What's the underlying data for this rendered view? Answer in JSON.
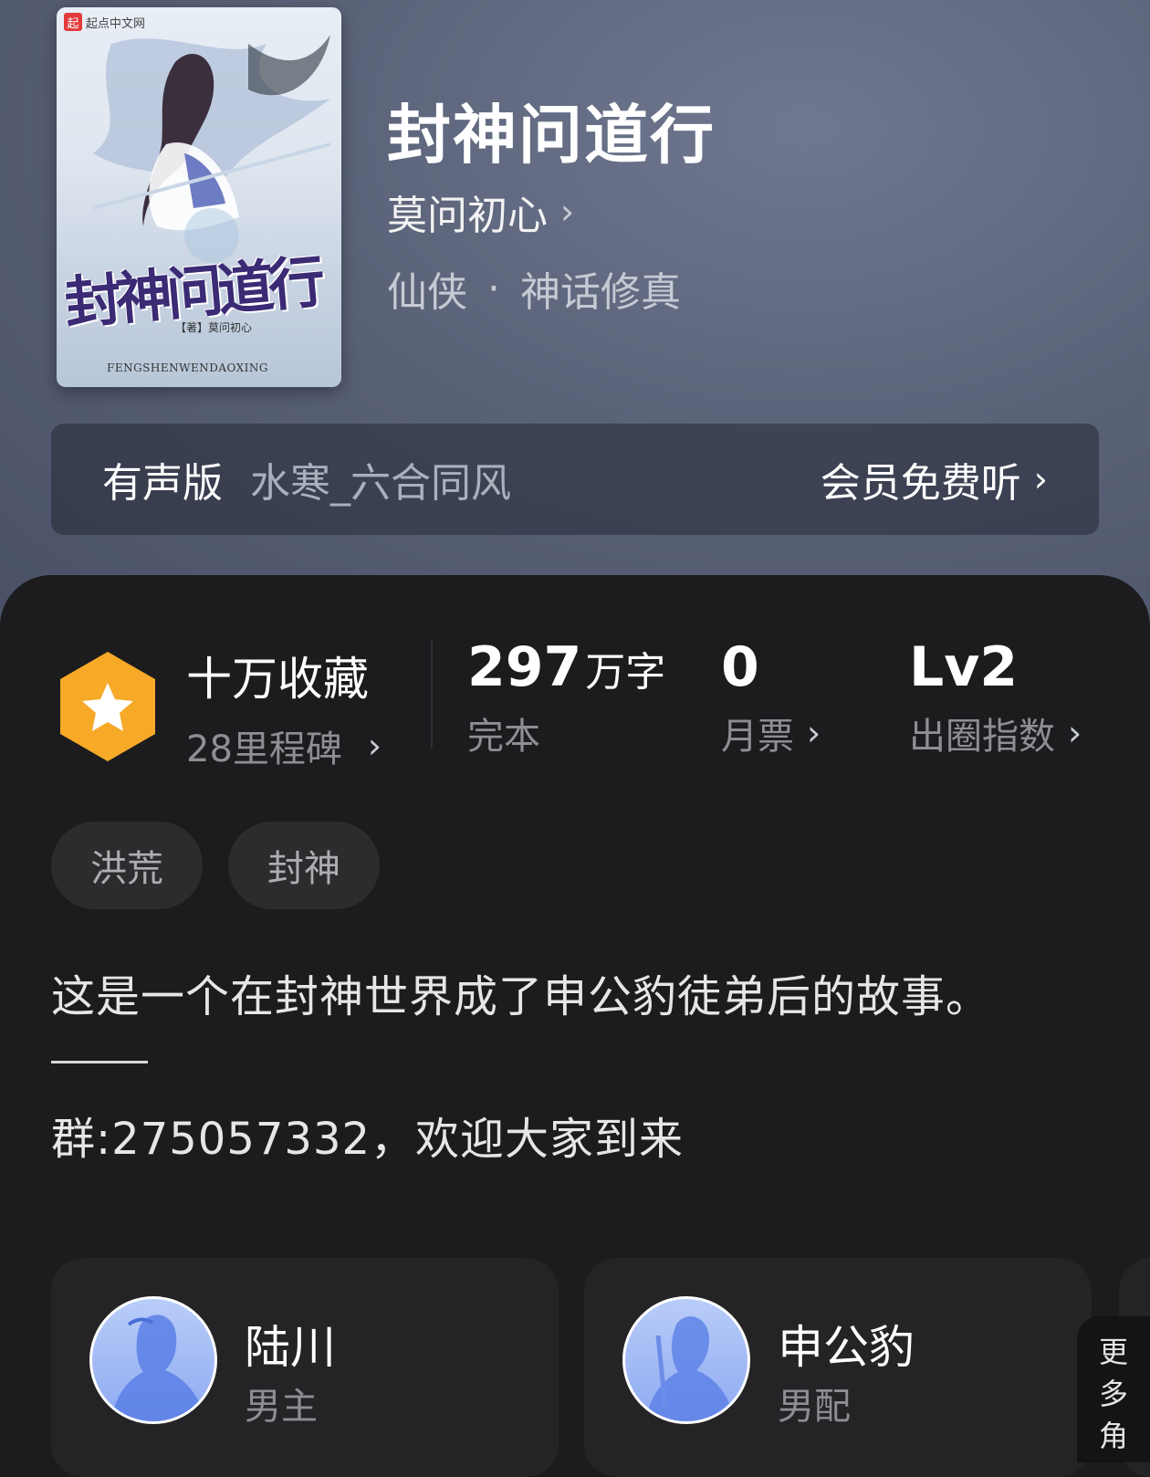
{
  "book": {
    "title": "封神问道行",
    "author": "莫问初心",
    "category": "仙侠",
    "separator": "·",
    "subcategory": "神话修真",
    "cover": {
      "publisher": "起点中文网",
      "publisher_mark": "起",
      "title_art": "封神问道行",
      "author_credit": "【著】莫问初心",
      "pinyin": "FENGSHENWENDAOXING"
    }
  },
  "audio": {
    "label": "有声版",
    "narrator": "水寒_六合同风",
    "cta": "会员免费听"
  },
  "stats": {
    "favorites": {
      "title": "十万收藏",
      "milestone": "28里程碑"
    },
    "words": {
      "number": "297",
      "unit": "万字",
      "status": "完本"
    },
    "monthly_tickets": {
      "number": "0",
      "label": "月票"
    },
    "breakout": {
      "number": "Lv2",
      "label": "出圈指数"
    }
  },
  "tags": [
    "洪荒",
    "封神"
  ],
  "description": {
    "line1": "这是一个在封神世界成了申公豹徒弟后的故事。",
    "line2": "群:275057332，欢迎大家到来"
  },
  "characters": [
    {
      "name": "陆川",
      "role": "男主"
    },
    {
      "name": "申公豹",
      "role": "男配"
    }
  ],
  "more_characters": [
    "更",
    "多",
    "角"
  ],
  "icons": {
    "chevron": "chevron-right-icon",
    "favorites_badge": "star-hexagon-icon"
  },
  "colors": {
    "badge_orange": "#f7a928",
    "panel_bg": "#1c1c1e",
    "avatar_blue": "#8eaaf2"
  }
}
